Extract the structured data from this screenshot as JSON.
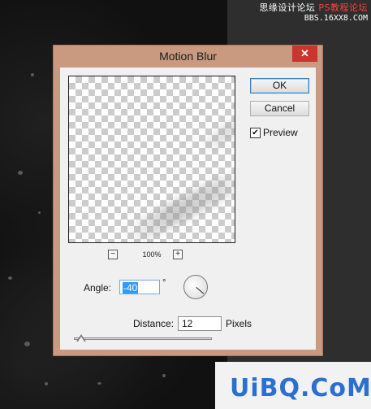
{
  "watermark": {
    "top_line1_prefix": "思缘设计论坛",
    "top_line1_suffix": "PS教程论坛",
    "top_line2": "BBS.16XX8.COM",
    "bottom": "UiBQ.CoM",
    "colors": {
      "red": "#ff4040",
      "blue": "#2c6fd1"
    }
  },
  "dialog": {
    "title": "Motion Blur",
    "close_glyph": "✕",
    "buttons": {
      "ok": "OK",
      "cancel": "Cancel"
    },
    "preview": {
      "label": "Preview",
      "checked": true,
      "check_glyph": "✔"
    },
    "zoom": {
      "minus": "−",
      "plus": "+",
      "level": "100%"
    },
    "angle": {
      "label": "Angle:",
      "value": "-40",
      "unit": "°"
    },
    "distance": {
      "label": "Distance:",
      "value": "12",
      "unit": "Pixels",
      "slider_fraction": 0.012
    },
    "title_bar_color": "#c99a7f",
    "close_color": "#c7372f"
  }
}
